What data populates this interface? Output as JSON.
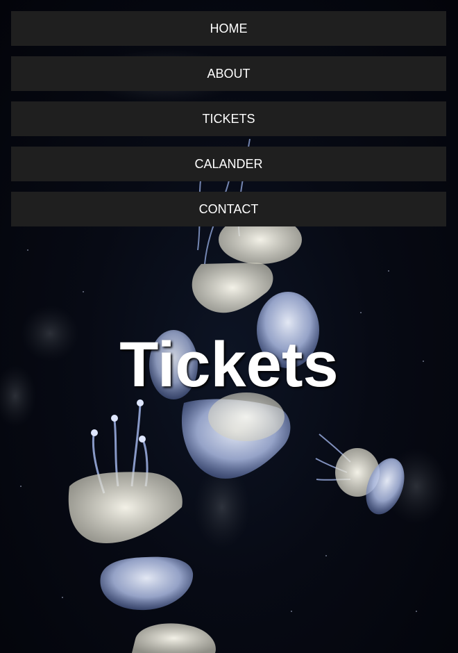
{
  "nav": {
    "items": [
      {
        "label": "HOME"
      },
      {
        "label": "ABOUT"
      },
      {
        "label": "TICKETS"
      },
      {
        "label": "CALANDER"
      },
      {
        "label": "CONTACT"
      }
    ]
  },
  "hero": {
    "title": "Tickets",
    "background_image": "jellyfish-photo"
  },
  "colors": {
    "nav_background": "#1f1f1f",
    "nav_text": "#ffffff",
    "title_text": "#ffffff",
    "page_background": "#05060c"
  }
}
